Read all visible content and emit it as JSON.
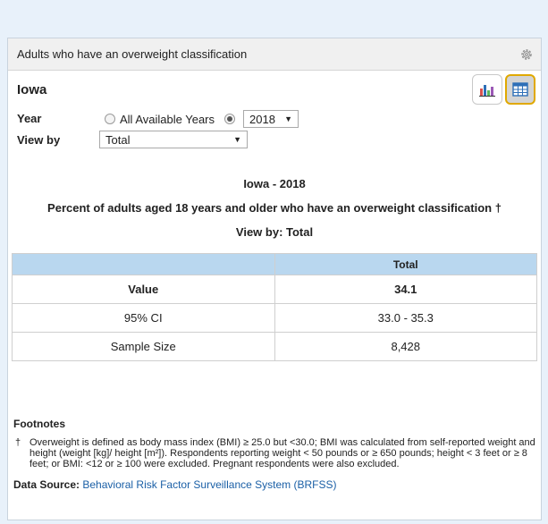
{
  "panel": {
    "title": "Adults who have an overweight classification",
    "location": "Iowa"
  },
  "filters": {
    "year_label": "Year",
    "all_years_label": "All Available Years",
    "year_value": "2018",
    "viewby_label": "View by",
    "viewby_value": "Total"
  },
  "heading": {
    "line1": "Iowa - 2018",
    "line2": "Percent of adults aged 18 years and older who have an overweight classification †",
    "line3": "View by: Total"
  },
  "table": {
    "column": "Total",
    "rows": [
      {
        "label": "Value",
        "value": "34.1"
      },
      {
        "label": "95% CI",
        "value": "33.0 - 35.3"
      },
      {
        "label": "Sample Size",
        "value": "8,428"
      }
    ]
  },
  "footnotes": {
    "heading": "Footnotes",
    "dagger": "†",
    "text": "Overweight is defined as body mass index (BMI) ≥ 25.0 but <30.0; BMI was calculated from self-reported weight and height (weight [kg]/ height [m²]). Respondents reporting weight < 50 pounds or ≥ 650 pounds; height < 3 feet or ≥ 8 feet; or BMI: <12 or ≥ 100 were excluded. Pregnant respondents were also excluded.",
    "source_label": "Data Source:",
    "source_link": "Behavioral Risk Factor Surveillance System (BRFSS)"
  },
  "colors": {
    "header_bg": "#f0f0f0",
    "table_header_bg": "#b9d7ef",
    "link": "#1a5fa6",
    "active_view_border": "#e0a800"
  },
  "icons": [
    "gear-icon",
    "bar-chart-icon",
    "table-icon"
  ]
}
